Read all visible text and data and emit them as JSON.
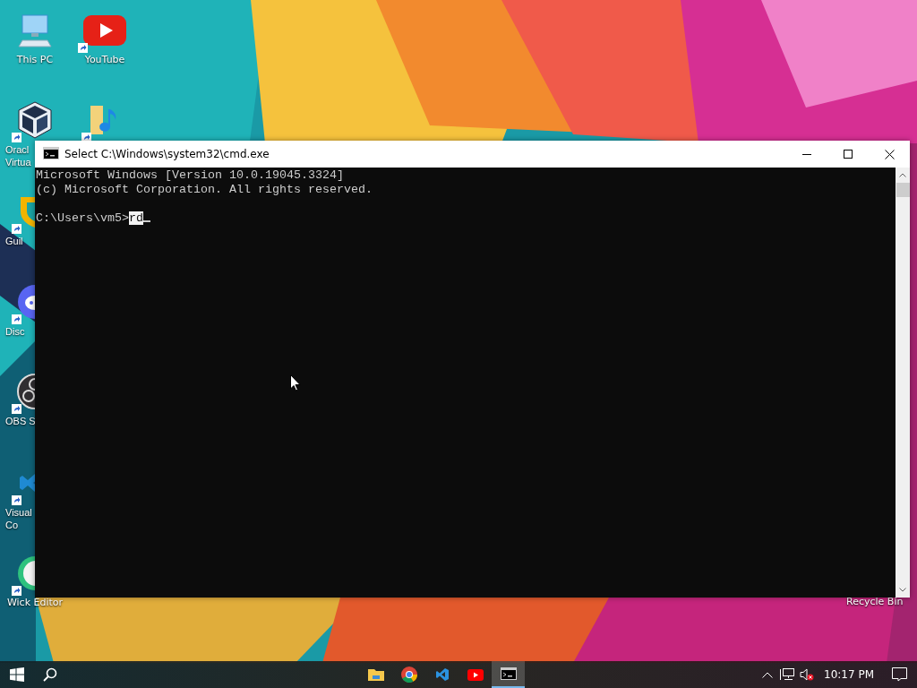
{
  "desktop_icons": [
    {
      "kind": "pc",
      "lines": [
        "This PC"
      ],
      "shortcut": false
    },
    {
      "kind": "youtube",
      "lines": [
        "YouTube"
      ],
      "shortcut": true
    },
    {
      "kind": "cube",
      "lines": [
        "Oracl",
        "Virtua"
      ],
      "shortcut": true
    },
    {
      "kind": "music",
      "shortcut": true
    },
    {
      "kind": "shield",
      "lines": [
        "Guil"
      ],
      "shortcut": true
    },
    {
      "kind": "chat",
      "lines": [
        "Disc"
      ],
      "shortcut": true
    },
    {
      "kind": "obs",
      "lines": [
        "OBS S"
      ],
      "shortcut": true
    },
    {
      "kind": "vscode",
      "lines": [
        "Visual",
        "Co"
      ],
      "shortcut": true
    },
    {
      "kind": "wick",
      "lines": [
        "Wick Editor"
      ],
      "shortcut": true
    }
  ],
  "recycle_bin": {
    "label": "Recycle Bin"
  },
  "window": {
    "title": "Select C:\\Windows\\system32\\cmd.exe",
    "console": {
      "lines": [
        "Microsoft Windows [Version 10.0.19045.3324]",
        "(c) Microsoft Corporation. All rights reserved."
      ],
      "prompt": "C:\\Users\\vm5>",
      "input": {
        "text": "rd",
        "selected": true
      }
    }
  },
  "taskbar": {
    "apps": [
      {
        "kind": "folder",
        "selected": false
      },
      {
        "kind": "chrome",
        "selected": false
      },
      {
        "kind": "vscode",
        "selected": false
      },
      {
        "kind": "youtube",
        "selected": false
      },
      {
        "kind": "terminal",
        "selected": true
      }
    ],
    "clock": "10:17 PM",
    "volume_muted": true
  }
}
